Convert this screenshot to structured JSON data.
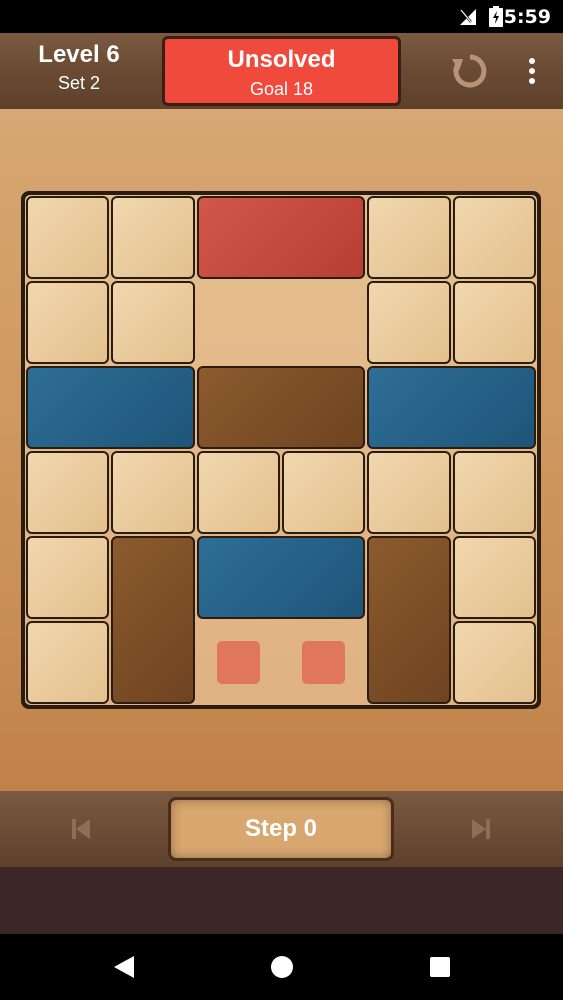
{
  "status_bar": {
    "time": "5:59",
    "icons": [
      "no-signal-icon",
      "battery-charging-icon"
    ]
  },
  "header": {
    "level_title": "Level 6",
    "level_set": "Set 2",
    "status_text": "Unsolved",
    "goal_text": "Goal 18",
    "status_color": "#f04a3c",
    "icons": [
      "reset-icon",
      "overflow-menu-icon"
    ]
  },
  "board": {
    "columns": 6,
    "rows": 6,
    "pieces": [
      {
        "color": "light",
        "col": 0,
        "row": 0,
        "w": 1,
        "h": 1
      },
      {
        "color": "light",
        "col": 1,
        "row": 0,
        "w": 1,
        "h": 1
      },
      {
        "color": "red",
        "col": 2,
        "row": 0,
        "w": 2,
        "h": 1
      },
      {
        "color": "light",
        "col": 4,
        "row": 0,
        "w": 1,
        "h": 1
      },
      {
        "color": "light",
        "col": 5,
        "row": 0,
        "w": 1,
        "h": 1
      },
      {
        "color": "light",
        "col": 0,
        "row": 1,
        "w": 1,
        "h": 1
      },
      {
        "color": "light",
        "col": 1,
        "row": 1,
        "w": 1,
        "h": 1
      },
      {
        "color": "light",
        "col": 4,
        "row": 1,
        "w": 1,
        "h": 1
      },
      {
        "color": "light",
        "col": 5,
        "row": 1,
        "w": 1,
        "h": 1
      },
      {
        "color": "blue",
        "col": 0,
        "row": 2,
        "w": 2,
        "h": 1
      },
      {
        "color": "brown",
        "col": 2,
        "row": 2,
        "w": 2,
        "h": 1
      },
      {
        "color": "blue",
        "col": 4,
        "row": 2,
        "w": 2,
        "h": 1
      },
      {
        "color": "light",
        "col": 0,
        "row": 3,
        "w": 1,
        "h": 1
      },
      {
        "color": "light",
        "col": 1,
        "row": 3,
        "w": 1,
        "h": 1
      },
      {
        "color": "light",
        "col": 2,
        "row": 3,
        "w": 1,
        "h": 1
      },
      {
        "color": "light",
        "col": 3,
        "row": 3,
        "w": 1,
        "h": 1
      },
      {
        "color": "light",
        "col": 4,
        "row": 3,
        "w": 1,
        "h": 1
      },
      {
        "color": "light",
        "col": 5,
        "row": 3,
        "w": 1,
        "h": 1
      },
      {
        "color": "light",
        "col": 0,
        "row": 4,
        "w": 1,
        "h": 1
      },
      {
        "color": "brown",
        "col": 1,
        "row": 4,
        "w": 1,
        "h": 2
      },
      {
        "color": "blue",
        "col": 2,
        "row": 4,
        "w": 2,
        "h": 1
      },
      {
        "color": "brown",
        "col": 4,
        "row": 4,
        "w": 1,
        "h": 2
      },
      {
        "color": "light",
        "col": 5,
        "row": 4,
        "w": 1,
        "h": 1
      },
      {
        "color": "light",
        "col": 0,
        "row": 5,
        "w": 1,
        "h": 1
      },
      {
        "color": "light",
        "col": 5,
        "row": 5,
        "w": 1,
        "h": 1
      }
    ],
    "targets": [
      {
        "col": 2,
        "row": 5
      },
      {
        "col": 3,
        "row": 5
      }
    ]
  },
  "footer": {
    "step_label": "Step 0",
    "icons": [
      "previous-step-icon",
      "next-step-icon"
    ]
  },
  "nav_bar": {
    "icons": [
      "back-icon",
      "home-icon",
      "recents-icon"
    ]
  }
}
